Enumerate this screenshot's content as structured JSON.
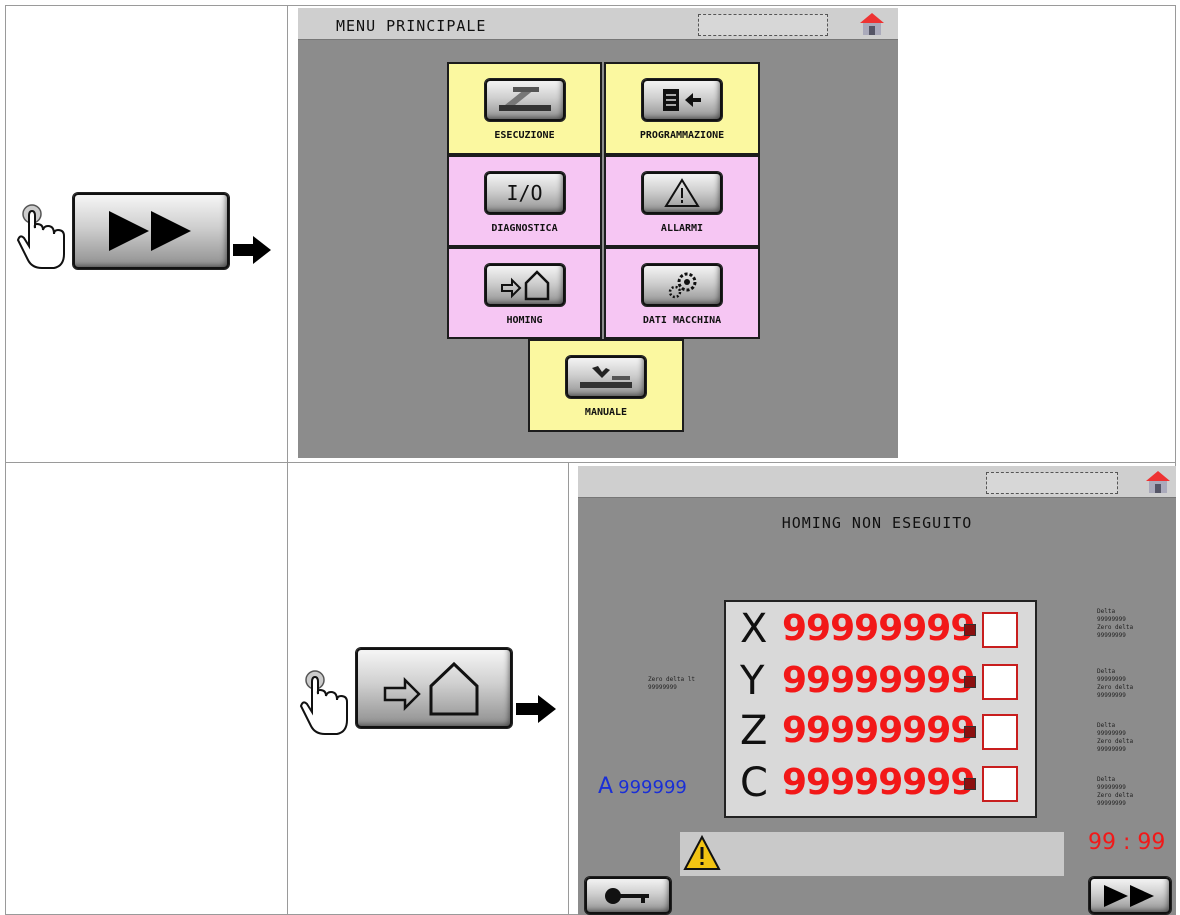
{
  "main_menu": {
    "title": "MENU PRINCIPALE",
    "tiles": [
      {
        "label": "ESECUZIONE",
        "color": "#fbf8a0",
        "icon": "cutting-machine-icon"
      },
      {
        "label": "PROGRAMMAZIONE",
        "color": "#fbf8a0",
        "icon": "document-arrow-icon"
      },
      {
        "label": "DIAGNOSTICA",
        "color": "#f6c6f3",
        "icon": "io-icon",
        "button_text": "I/O"
      },
      {
        "label": "ALLARMI",
        "color": "#f6c6f3",
        "icon": "warning-icon"
      },
      {
        "label": "HOMING",
        "color": "#f6c6f3",
        "icon": "home-arrow-icon"
      },
      {
        "label": "DATI MACCHINA",
        "color": "#f6c6f3",
        "icon": "gears-icon"
      },
      {
        "label": "MANUALE",
        "color": "#fbf8a0",
        "icon": "manual-machine-icon"
      }
    ]
  },
  "homing_screen": {
    "title": "HOMING NON ESEGUITO",
    "axes": [
      {
        "letter": "X",
        "value": "99999999"
      },
      {
        "letter": "Y",
        "value": "99999999"
      },
      {
        "letter": "Z",
        "value": "99999999"
      },
      {
        "letter": "C",
        "value": "99999999"
      }
    ],
    "left_note": "Zero delta lt\n99999999",
    "a_label": "A",
    "a_value": "999999",
    "right_notes": [
      "Delta\n99999999\nZero delta\n99999999",
      "Delta\n99999999\nZero delta\n99999999",
      "Delta\n99999999\nZero delta\n99999999",
      "Delta\n99999999\nZero delta\n99999999"
    ],
    "timer": "99 : 99"
  },
  "colors": {
    "accent_red": "#f21818",
    "accent_blue": "#1a2fd6",
    "yellow_tile": "#fbf8a0",
    "pink_tile": "#f6c6f3"
  }
}
